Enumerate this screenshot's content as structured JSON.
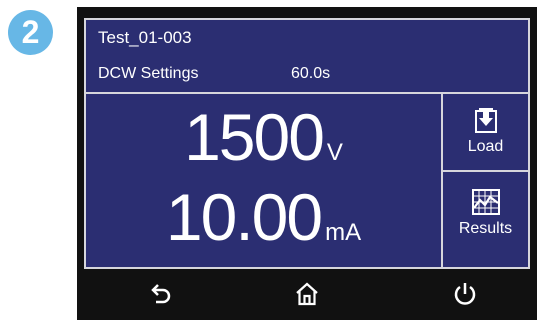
{
  "step": {
    "number": "2",
    "color": "#67b7e6"
  },
  "colors": {
    "screen_bg": "#2b2e72",
    "bezel": "#111111",
    "border": "#d6d6dc",
    "text": "#ffffff"
  },
  "header": {
    "test_name": "Test_01-003",
    "mode": "DCW Settings",
    "dwell_time": "60.0s"
  },
  "readout": {
    "voltage_value": "1500",
    "voltage_unit": "V",
    "current_value": "10.00",
    "current_unit": "mA"
  },
  "side_buttons": [
    {
      "label": "Load",
      "icon": "load-icon"
    },
    {
      "label": "Results",
      "icon": "results-graph-icon"
    }
  ],
  "nav": [
    {
      "icon": "back-icon"
    },
    {
      "icon": "home-icon"
    },
    {
      "icon": "power-icon"
    }
  ]
}
